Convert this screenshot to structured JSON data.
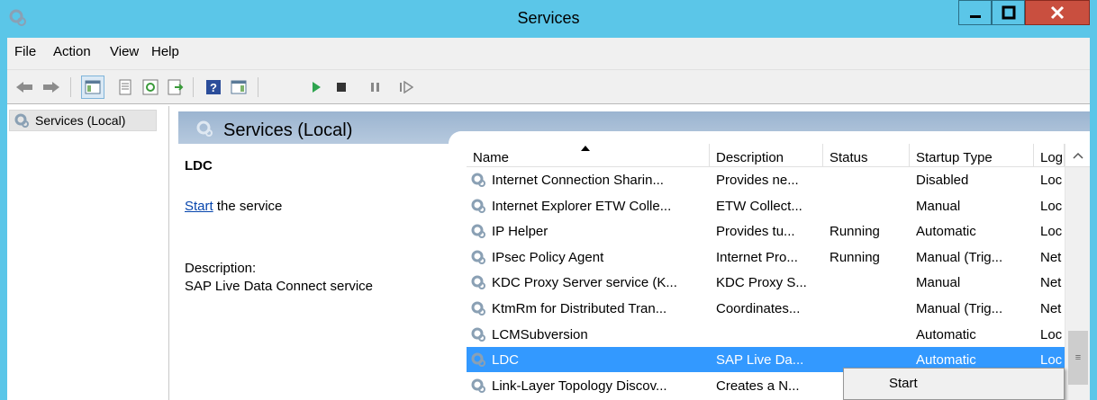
{
  "window": {
    "title": "Services",
    "icon": "services-gear-icon",
    "controls": {
      "minimize": "minimize-icon",
      "maximize": "maximize-icon",
      "close": "close-icon"
    }
  },
  "menubar": {
    "items": [
      "File",
      "Action",
      "View",
      "Help"
    ]
  },
  "toolbar": {
    "buttons": [
      "back-arrow-icon",
      "forward-arrow-icon",
      "console-tree-icon",
      "properties-icon",
      "refresh-icon",
      "export-list-icon",
      "help-icon",
      "show-hide-action-pane-icon",
      "start-service-icon",
      "stop-service-icon",
      "pause-service-icon",
      "resume-service-icon"
    ]
  },
  "tree": {
    "item": "Services (Local)"
  },
  "detail": {
    "header": "Services (Local)",
    "service_name": "LDC",
    "start_link": "Start",
    "start_suffix": " the service",
    "description_label": "Description:",
    "description": "SAP Live Data Connect service"
  },
  "columns": [
    "Name",
    "Description",
    "Status",
    "Startup Type",
    "Log"
  ],
  "rows": [
    {
      "name": "Internet Connection Sharin...",
      "description": "Provides ne...",
      "status": "",
      "startup": "Disabled",
      "log": "Loc"
    },
    {
      "name": "Internet Explorer ETW Colle...",
      "description": "ETW Collect...",
      "status": "",
      "startup": "Manual",
      "log": "Loc"
    },
    {
      "name": "IP Helper",
      "description": "Provides tu...",
      "status": "Running",
      "startup": "Automatic",
      "log": "Loc"
    },
    {
      "name": "IPsec Policy Agent",
      "description": "Internet Pro...",
      "status": "Running",
      "startup": "Manual (Trig...",
      "log": "Net"
    },
    {
      "name": "KDC Proxy Server service (K...",
      "description": "KDC Proxy S...",
      "status": "",
      "startup": "Manual",
      "log": "Net"
    },
    {
      "name": "KtmRm for Distributed Tran...",
      "description": "Coordinates...",
      "status": "",
      "startup": "Manual (Trig...",
      "log": "Net"
    },
    {
      "name": "LCMSubversion",
      "description": "",
      "status": "",
      "startup": "Automatic",
      "log": "Loc"
    },
    {
      "name": "LDC",
      "description": "SAP Live Da...",
      "status": "",
      "startup": "Automatic",
      "log": "Loc"
    },
    {
      "name": "Link-Layer Topology Discov...",
      "description": "Creates a N...",
      "status": "",
      "startup": "",
      "log": "Loc"
    }
  ],
  "selected_row": "LDC",
  "context_menu": {
    "items": [
      "Start"
    ]
  },
  "colors": {
    "title_bar": "#5bc6e8",
    "selection": "#3399ff",
    "close_button": "#c94f3f"
  }
}
